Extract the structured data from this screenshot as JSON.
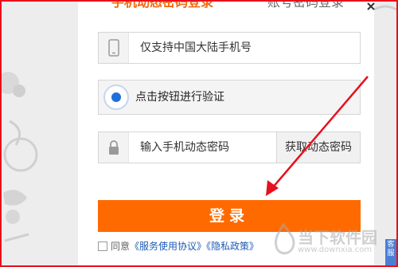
{
  "tabs": [
    {
      "label": "手机动态密码登录",
      "active": true
    },
    {
      "label": "账号密码登录",
      "active": false
    }
  ],
  "phone_field": {
    "placeholder": "仅支持中国大陆手机号",
    "icon": "phone-icon"
  },
  "captcha": {
    "label": "点击按钮进行验证",
    "icon": "captcha-icon"
  },
  "code_field": {
    "placeholder": "输入手机动态密码",
    "icon": "lock-icon",
    "get_code_label": "获取动态密码"
  },
  "login_button": {
    "label": "登录"
  },
  "agreement": {
    "prefix": "同意",
    "service_link": "《服务使用协议》",
    "privacy_link": "《隐私政策》"
  },
  "side_tab": {
    "label": "客服"
  },
  "watermark": {
    "title": "当下软件园",
    "subtitle": "www.downxia.com"
  },
  "colors": {
    "accent": "#ff6a00",
    "frame": "#e8101c",
    "link": "#1d5bb7",
    "annotation_arrow": "#e8101c"
  }
}
